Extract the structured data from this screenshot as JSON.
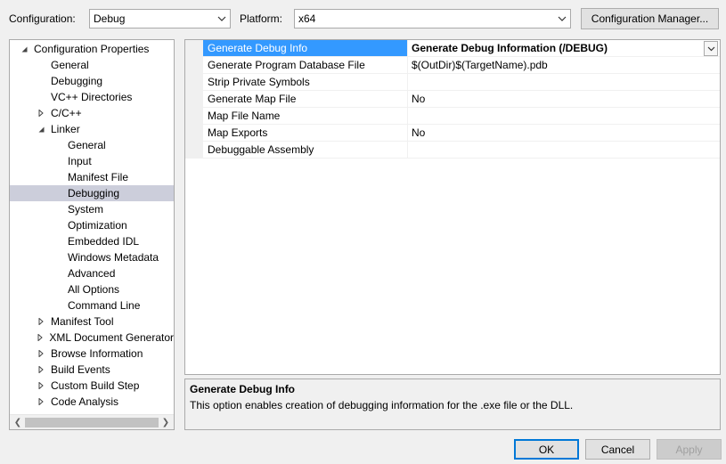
{
  "top": {
    "configuration_label": "Configuration:",
    "configuration_value": "Debug",
    "platform_label": "Platform:",
    "platform_value": "x64",
    "config_manager_button": "Configuration Manager..."
  },
  "tree": {
    "items": [
      {
        "label": "Configuration Properties",
        "expander": "collapse",
        "level": 0
      },
      {
        "label": "General",
        "expander": "none",
        "level": 1
      },
      {
        "label": "Debugging",
        "expander": "none",
        "level": 1
      },
      {
        "label": "VC++ Directories",
        "expander": "none",
        "level": 1
      },
      {
        "label": "C/C++",
        "expander": "expand",
        "level": 1
      },
      {
        "label": "Linker",
        "expander": "collapse",
        "level": 1
      },
      {
        "label": "General",
        "expander": "none",
        "level": 2
      },
      {
        "label": "Input",
        "expander": "none",
        "level": 2
      },
      {
        "label": "Manifest File",
        "expander": "none",
        "level": 2
      },
      {
        "label": "Debugging",
        "expander": "none",
        "level": 2
      },
      {
        "label": "System",
        "expander": "none",
        "level": 2
      },
      {
        "label": "Optimization",
        "expander": "none",
        "level": 2
      },
      {
        "label": "Embedded IDL",
        "expander": "none",
        "level": 2
      },
      {
        "label": "Windows Metadata",
        "expander": "none",
        "level": 2
      },
      {
        "label": "Advanced",
        "expander": "none",
        "level": 2
      },
      {
        "label": "All Options",
        "expander": "none",
        "level": 2
      },
      {
        "label": "Command Line",
        "expander": "none",
        "level": 2
      },
      {
        "label": "Manifest Tool",
        "expander": "expand",
        "level": 1
      },
      {
        "label": "XML Document Generator",
        "expander": "expand",
        "level": 1
      },
      {
        "label": "Browse Information",
        "expander": "expand",
        "level": 1
      },
      {
        "label": "Build Events",
        "expander": "expand",
        "level": 1
      },
      {
        "label": "Custom Build Step",
        "expander": "expand",
        "level": 1
      },
      {
        "label": "Code Analysis",
        "expander": "expand",
        "level": 1
      }
    ],
    "selected_item": "Debugging (Linker)"
  },
  "properties": [
    {
      "name": "Generate Debug Info",
      "value": "Generate Debug Information (/DEBUG)",
      "selected": true
    },
    {
      "name": "Generate Program Database File",
      "value": "$(OutDir)$(TargetName).pdb"
    },
    {
      "name": "Strip Private Symbols",
      "value": ""
    },
    {
      "name": "Generate Map File",
      "value": "No"
    },
    {
      "name": "Map File Name",
      "value": ""
    },
    {
      "name": "Map Exports",
      "value": "No"
    },
    {
      "name": "Debuggable Assembly",
      "value": ""
    }
  ],
  "description": {
    "title": "Generate Debug Info",
    "text": "This option enables creation of debugging information for the .exe file or the DLL."
  },
  "buttons": {
    "ok": "OK",
    "cancel": "Cancel",
    "apply": "Apply"
  },
  "icons": {
    "combo_arrow": "chevron-down-icon",
    "expand": "triangle-right-icon",
    "collapse": "triangle-down-icon"
  }
}
